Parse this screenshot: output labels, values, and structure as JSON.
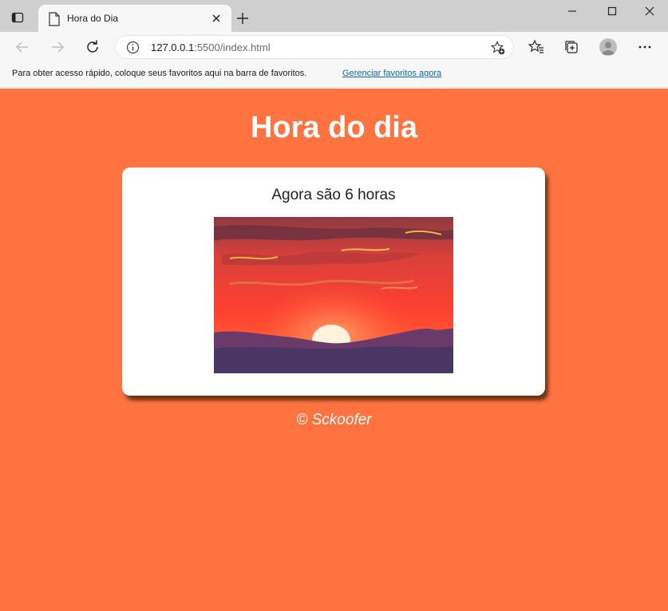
{
  "browser": {
    "tab_title": "Hora do Dia",
    "url_host": "127.0.0.1",
    "url_rest": ":5500/index.html",
    "favorites_message": "Para obter acesso rápido, coloque seus favoritos aqui na barra de favoritos.",
    "favorites_link": "Gerenciar favoritos agora",
    "icons": [
      "tab-actions-icon",
      "page-icon",
      "close-icon",
      "plus-icon",
      "minimize-icon",
      "maximize-icon",
      "close-window-icon",
      "back-arrow-icon",
      "forward-arrow-icon",
      "refresh-icon",
      "info-icon",
      "add-favorite-icon",
      "favorites-icon",
      "collections-icon",
      "profile-avatar-icon",
      "more-icon"
    ]
  },
  "page": {
    "title": "Hora do dia",
    "message": "Agora são 6 horas",
    "footer": "© Sckoofer",
    "background_color": "#ff7341",
    "image_subject": "sunset over mountains"
  }
}
